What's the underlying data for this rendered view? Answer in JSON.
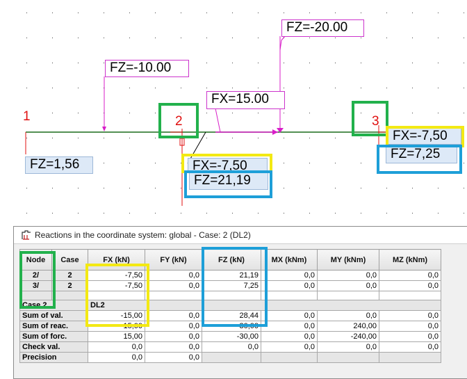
{
  "viewport": {
    "nodes": [
      {
        "number": "1"
      },
      {
        "number": "2"
      },
      {
        "number": "3"
      }
    ],
    "load_labels": {
      "fz_load_1": "FZ=-10.00",
      "fz_load_2": "FZ=-20.00",
      "fx_load": "FX=15.00"
    },
    "reaction_labels": {
      "node1_fz": "FZ=1,56",
      "node2_fx": "FX=-7,50",
      "node2_fz": "FZ=21,19",
      "node3_fx": "FX=-7,50",
      "node3_fz": "FZ=7,25"
    },
    "colors": {
      "beam": "#1a6b1a",
      "load": "#d81ec8",
      "reaction": "#e01010",
      "highlight_green": "#22b14c",
      "highlight_yellow": "#f3e914",
      "highlight_blue": "#1e9fd8"
    }
  },
  "reactions_window": {
    "title": "Reactions in the coordinate system: global - Case: 2 (DL2)",
    "icon": "reactions-app-icon",
    "columns": [
      "Node",
      "Case",
      "FX (kN)",
      "FY (kN)",
      "FZ (kN)",
      "MX (kNm)",
      "MY (kNm)",
      "MZ (kNm)"
    ],
    "node_rows": [
      {
        "node": "2/",
        "case": "2",
        "fx": "-7,50",
        "fy": "0,0",
        "fz": "21,19",
        "mx": "0,0",
        "my": "0,0",
        "mz": "0,0"
      },
      {
        "node": "3/",
        "case": "2",
        "fx": "-7,50",
        "fy": "0,0",
        "fz": "7,25",
        "mx": "0,0",
        "my": "0,0",
        "mz": "0,0"
      }
    ],
    "case_row": {
      "label": "Case 2",
      "value": "DL2"
    },
    "summary_rows": [
      {
        "label": "Sum of val.",
        "fx": "-15,00",
        "fy": "0,0",
        "fz": "28,44",
        "mx": "0,0",
        "my": "0,0",
        "mz": "0,0"
      },
      {
        "label": "Sum of reac.",
        "fx": "-15,00",
        "fy": "0,0",
        "fz": "30,00",
        "mx": "0,0",
        "my": "240,00",
        "mz": "0,0"
      },
      {
        "label": "Sum of forc.",
        "fx": "15,00",
        "fy": "0,0",
        "fz": "-30,00",
        "mx": "0,0",
        "my": "-240,00",
        "mz": "0,0"
      },
      {
        "label": "Check val.",
        "fx": "0,0",
        "fy": "0,0",
        "fz": "0,0",
        "mx": "0,0",
        "my": "0,0",
        "mz": "0,0"
      },
      {
        "label": "Precision",
        "fx": "0,0",
        "fy": "0,0",
        "fz": "",
        "mx": "",
        "my": "",
        "mz": ""
      }
    ]
  }
}
